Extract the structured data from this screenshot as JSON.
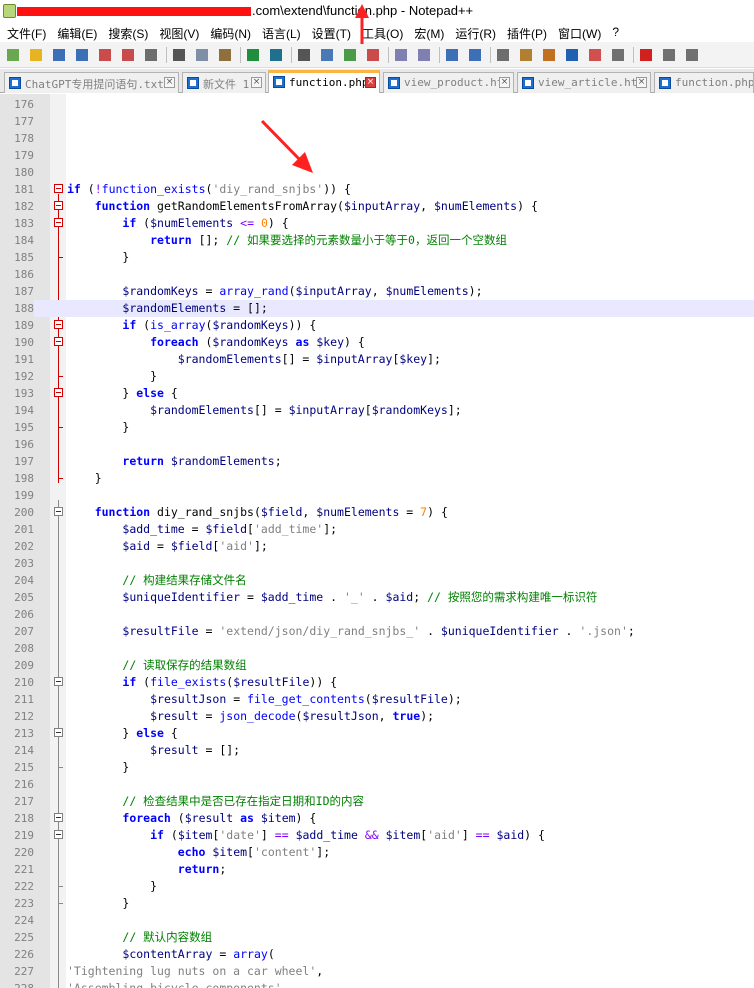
{
  "window": {
    "title": ".com\\extend\\function.php - Notepad++"
  },
  "menu": [
    "文件(F)",
    "编辑(E)",
    "搜索(S)",
    "视图(V)",
    "编码(N)",
    "语言(L)",
    "设置(T)",
    "工具(O)",
    "宏(M)",
    "运行(R)",
    "插件(P)",
    "窗口(W)",
    "?"
  ],
  "toolbar": {
    "buttons": [
      "new-file-icon",
      "open-file-icon",
      "save-icon",
      "save-all-icon",
      "close-icon",
      "close-all-icon",
      "print-icon",
      "cut-icon",
      "copy-icon",
      "paste-icon",
      "undo-icon",
      "redo-icon",
      "find-icon",
      "replace-icon",
      "zoom-in-icon",
      "zoom-out-icon",
      "sync-vertical-icon",
      "sync-horizontal-icon",
      "word-wrap-icon",
      "show-all-chars-icon",
      "indent-guide-icon",
      "doc-map-icon",
      "function-list-icon",
      "folder-workspace-icon",
      "document-list-icon",
      "monitoring-icon",
      "record-macro-icon",
      "stop-record-icon",
      "play-macro-icon"
    ]
  },
  "tabs": [
    {
      "label": "ChatGPT专用提问语句.txt",
      "active": false
    },
    {
      "label": "新文件 1",
      "active": false
    },
    {
      "label": "function.php",
      "active": true
    },
    {
      "label": "view_product.htm",
      "active": false
    },
    {
      "label": "view_article.htm",
      "active": false
    },
    {
      "label": "function.php",
      "active": false
    }
  ],
  "editor": {
    "current_line": 188,
    "lines": [
      {
        "n": "176",
        "t": []
      },
      {
        "n": "177",
        "t": []
      },
      {
        "n": "178",
        "t": []
      },
      {
        "n": "179",
        "t": []
      },
      {
        "n": "180",
        "t": []
      },
      {
        "n": "181",
        "t": [
          [
            "kw",
            "if"
          ],
          [
            "plain",
            " ("
          ],
          [
            "op",
            "!"
          ],
          [
            "fn",
            "function_exists"
          ],
          [
            "plain",
            "("
          ],
          [
            "str",
            "'diy_rand_snjbs'"
          ],
          [
            "plain",
            ")) {"
          ]
        ]
      },
      {
        "n": "182",
        "t": [
          [
            "plain",
            "    "
          ],
          [
            "kw",
            "function"
          ],
          [
            "plain",
            " getRandomElementsFromArray("
          ],
          [
            "var",
            "$inputArray"
          ],
          [
            "plain",
            ", "
          ],
          [
            "var",
            "$numElements"
          ],
          [
            "plain",
            ") {"
          ]
        ]
      },
      {
        "n": "183",
        "t": [
          [
            "plain",
            "        "
          ],
          [
            "kw",
            "if"
          ],
          [
            "plain",
            " ("
          ],
          [
            "var",
            "$numElements"
          ],
          [
            "plain",
            " "
          ],
          [
            "op",
            "<="
          ],
          [
            "plain",
            " "
          ],
          [
            "num",
            "0"
          ],
          [
            "plain",
            ") {"
          ]
        ]
      },
      {
        "n": "184",
        "t": [
          [
            "plain",
            "            "
          ],
          [
            "kw",
            "return"
          ],
          [
            "plain",
            " []; "
          ],
          [
            "cm",
            "// 如果要选择的元素数量小于等于0，返回一个空数组"
          ]
        ]
      },
      {
        "n": "185",
        "t": [
          [
            "plain",
            "        }"
          ]
        ]
      },
      {
        "n": "186",
        "t": []
      },
      {
        "n": "187",
        "t": [
          [
            "plain",
            "        "
          ],
          [
            "var",
            "$randomKeys"
          ],
          [
            "plain",
            " = "
          ],
          [
            "fn",
            "array_rand"
          ],
          [
            "plain",
            "("
          ],
          [
            "var",
            "$inputArray"
          ],
          [
            "plain",
            ", "
          ],
          [
            "var",
            "$numElements"
          ],
          [
            "plain",
            ");"
          ]
        ]
      },
      {
        "n": "188",
        "t": [
          [
            "plain",
            "        "
          ],
          [
            "var",
            "$randomElements"
          ],
          [
            "plain",
            " = [];"
          ]
        ]
      },
      {
        "n": "189",
        "t": [
          [
            "plain",
            "        "
          ],
          [
            "kw",
            "if"
          ],
          [
            "plain",
            " ("
          ],
          [
            "fn",
            "is_array"
          ],
          [
            "plain",
            "("
          ],
          [
            "var",
            "$randomKeys"
          ],
          [
            "plain",
            ")) {"
          ]
        ]
      },
      {
        "n": "190",
        "t": [
          [
            "plain",
            "            "
          ],
          [
            "kw",
            "foreach"
          ],
          [
            "plain",
            " ("
          ],
          [
            "var",
            "$randomKeys"
          ],
          [
            "plain",
            " "
          ],
          [
            "kw",
            "as"
          ],
          [
            "plain",
            " "
          ],
          [
            "var",
            "$key"
          ],
          [
            "plain",
            ") {"
          ]
        ]
      },
      {
        "n": "191",
        "t": [
          [
            "plain",
            "                "
          ],
          [
            "var",
            "$randomElements"
          ],
          [
            "plain",
            "[] = "
          ],
          [
            "var",
            "$inputArray"
          ],
          [
            "plain",
            "["
          ],
          [
            "var",
            "$key"
          ],
          [
            "plain",
            "];"
          ]
        ]
      },
      {
        "n": "192",
        "t": [
          [
            "plain",
            "            }"
          ]
        ]
      },
      {
        "n": "193",
        "t": [
          [
            "plain",
            "        } "
          ],
          [
            "kw",
            "else"
          ],
          [
            "plain",
            " {"
          ]
        ]
      },
      {
        "n": "194",
        "t": [
          [
            "plain",
            "            "
          ],
          [
            "var",
            "$randomElements"
          ],
          [
            "plain",
            "[] = "
          ],
          [
            "var",
            "$inputArray"
          ],
          [
            "plain",
            "["
          ],
          [
            "var",
            "$randomKeys"
          ],
          [
            "plain",
            "];"
          ]
        ]
      },
      {
        "n": "195",
        "t": [
          [
            "plain",
            "        }"
          ]
        ]
      },
      {
        "n": "196",
        "t": []
      },
      {
        "n": "197",
        "t": [
          [
            "plain",
            "        "
          ],
          [
            "kw",
            "return"
          ],
          [
            "plain",
            " "
          ],
          [
            "var",
            "$randomElements"
          ],
          [
            "plain",
            ";"
          ]
        ]
      },
      {
        "n": "198",
        "t": [
          [
            "plain",
            "    }"
          ]
        ]
      },
      {
        "n": "199",
        "t": []
      },
      {
        "n": "200",
        "t": [
          [
            "plain",
            "    "
          ],
          [
            "kw",
            "function"
          ],
          [
            "plain",
            " diy_rand_snjbs("
          ],
          [
            "var",
            "$field"
          ],
          [
            "plain",
            ", "
          ],
          [
            "var",
            "$numElements"
          ],
          [
            "plain",
            " = "
          ],
          [
            "num",
            "7"
          ],
          [
            "plain",
            ") {"
          ]
        ]
      },
      {
        "n": "201",
        "t": [
          [
            "plain",
            "        "
          ],
          [
            "var",
            "$add_time"
          ],
          [
            "plain",
            " = "
          ],
          [
            "var",
            "$field"
          ],
          [
            "plain",
            "["
          ],
          [
            "str",
            "'add_time'"
          ],
          [
            "plain",
            "];"
          ]
        ]
      },
      {
        "n": "202",
        "t": [
          [
            "plain",
            "        "
          ],
          [
            "var",
            "$aid"
          ],
          [
            "plain",
            " = "
          ],
          [
            "var",
            "$field"
          ],
          [
            "plain",
            "["
          ],
          [
            "str",
            "'aid'"
          ],
          [
            "plain",
            "];"
          ]
        ]
      },
      {
        "n": "203",
        "t": []
      },
      {
        "n": "204",
        "t": [
          [
            "plain",
            "        "
          ],
          [
            "cm",
            "// 构建结果存储文件名"
          ]
        ]
      },
      {
        "n": "205",
        "t": [
          [
            "plain",
            "        "
          ],
          [
            "var",
            "$uniqueIdentifier"
          ],
          [
            "plain",
            " = "
          ],
          [
            "var",
            "$add_time"
          ],
          [
            "plain",
            " . "
          ],
          [
            "str",
            "'_'"
          ],
          [
            "plain",
            " . "
          ],
          [
            "var",
            "$aid"
          ],
          [
            "plain",
            "; "
          ],
          [
            "cm",
            "// 按照您的需求构建唯一标识符"
          ]
        ]
      },
      {
        "n": "206",
        "t": []
      },
      {
        "n": "207",
        "t": [
          [
            "plain",
            "        "
          ],
          [
            "var",
            "$resultFile"
          ],
          [
            "plain",
            " = "
          ],
          [
            "str",
            "'extend/json/diy_rand_snjbs_'"
          ],
          [
            "plain",
            " . "
          ],
          [
            "var",
            "$uniqueIdentifier"
          ],
          [
            "plain",
            " . "
          ],
          [
            "str",
            "'.json'"
          ],
          [
            "plain",
            ";"
          ]
        ]
      },
      {
        "n": "208",
        "t": []
      },
      {
        "n": "209",
        "t": [
          [
            "plain",
            "        "
          ],
          [
            "cm",
            "// 读取保存的结果数组"
          ]
        ]
      },
      {
        "n": "210",
        "t": [
          [
            "plain",
            "        "
          ],
          [
            "kw",
            "if"
          ],
          [
            "plain",
            " ("
          ],
          [
            "fn",
            "file_exists"
          ],
          [
            "plain",
            "("
          ],
          [
            "var",
            "$resultFile"
          ],
          [
            "plain",
            ")) {"
          ]
        ]
      },
      {
        "n": "211",
        "t": [
          [
            "plain",
            "            "
          ],
          [
            "var",
            "$resultJson"
          ],
          [
            "plain",
            " = "
          ],
          [
            "fn",
            "file_get_contents"
          ],
          [
            "plain",
            "("
          ],
          [
            "var",
            "$resultFile"
          ],
          [
            "plain",
            ");"
          ]
        ]
      },
      {
        "n": "212",
        "t": [
          [
            "plain",
            "            "
          ],
          [
            "var",
            "$result"
          ],
          [
            "plain",
            " = "
          ],
          [
            "fn",
            "json_decode"
          ],
          [
            "plain",
            "("
          ],
          [
            "var",
            "$resultJson"
          ],
          [
            "plain",
            ", "
          ],
          [
            "kw",
            "true"
          ],
          [
            "plain",
            ");"
          ]
        ]
      },
      {
        "n": "213",
        "t": [
          [
            "plain",
            "        } "
          ],
          [
            "kw",
            "else"
          ],
          [
            "plain",
            " {"
          ]
        ]
      },
      {
        "n": "214",
        "t": [
          [
            "plain",
            "            "
          ],
          [
            "var",
            "$result"
          ],
          [
            "plain",
            " = [];"
          ]
        ]
      },
      {
        "n": "215",
        "t": [
          [
            "plain",
            "        }"
          ]
        ]
      },
      {
        "n": "216",
        "t": []
      },
      {
        "n": "217",
        "t": [
          [
            "plain",
            "        "
          ],
          [
            "cm",
            "// 检查结果中是否已存在指定日期和ID的内容"
          ]
        ]
      },
      {
        "n": "218",
        "t": [
          [
            "plain",
            "        "
          ],
          [
            "kw",
            "foreach"
          ],
          [
            "plain",
            " ("
          ],
          [
            "var",
            "$result"
          ],
          [
            "plain",
            " "
          ],
          [
            "kw",
            "as"
          ],
          [
            "plain",
            " "
          ],
          [
            "var",
            "$item"
          ],
          [
            "plain",
            ") {"
          ]
        ]
      },
      {
        "n": "219",
        "t": [
          [
            "plain",
            "            "
          ],
          [
            "kw",
            "if"
          ],
          [
            "plain",
            " ("
          ],
          [
            "var",
            "$item"
          ],
          [
            "plain",
            "["
          ],
          [
            "str",
            "'date'"
          ],
          [
            "plain",
            "] "
          ],
          [
            "op",
            "=="
          ],
          [
            "plain",
            " "
          ],
          [
            "var",
            "$add_time"
          ],
          [
            "plain",
            " "
          ],
          [
            "op",
            "&&"
          ],
          [
            "plain",
            " "
          ],
          [
            "var",
            "$item"
          ],
          [
            "plain",
            "["
          ],
          [
            "str",
            "'aid'"
          ],
          [
            "plain",
            "] "
          ],
          [
            "op",
            "=="
          ],
          [
            "plain",
            " "
          ],
          [
            "var",
            "$aid"
          ],
          [
            "plain",
            ") {"
          ]
        ]
      },
      {
        "n": "220",
        "t": [
          [
            "plain",
            "                "
          ],
          [
            "kw",
            "echo"
          ],
          [
            "plain",
            " "
          ],
          [
            "var",
            "$item"
          ],
          [
            "plain",
            "["
          ],
          [
            "str",
            "'content'"
          ],
          [
            "plain",
            "];"
          ]
        ]
      },
      {
        "n": "221",
        "t": [
          [
            "plain",
            "                "
          ],
          [
            "kw",
            "return"
          ],
          [
            "plain",
            ";"
          ]
        ]
      },
      {
        "n": "222",
        "t": [
          [
            "plain",
            "            }"
          ]
        ]
      },
      {
        "n": "223",
        "t": [
          [
            "plain",
            "        }"
          ]
        ]
      },
      {
        "n": "224",
        "t": []
      },
      {
        "n": "225",
        "t": [
          [
            "plain",
            "        "
          ],
          [
            "cm",
            "// 默认内容数组"
          ]
        ]
      },
      {
        "n": "226",
        "t": [
          [
            "plain",
            "        "
          ],
          [
            "var",
            "$contentArray"
          ],
          [
            "plain",
            " = "
          ],
          [
            "fn",
            "array"
          ],
          [
            "plain",
            "("
          ]
        ]
      },
      {
        "n": "227",
        "t": [
          [
            "str",
            "'Tightening lug nuts on a car wheel'"
          ],
          [
            "plain",
            ","
          ]
        ]
      },
      {
        "n": "228",
        "t": [
          [
            "str",
            "'Assembling bicycle components'"
          ]
        ]
      }
    ]
  },
  "colors": {
    "keyword": "#0000ff",
    "variable": "#000080",
    "string": "#808080",
    "number": "#ff8000",
    "operator": "#8000ff",
    "comment": "#008000",
    "current_line": "#e8e8ff",
    "fold_marker_changed": "#d00000",
    "annotation_arrow": "#ff1111"
  }
}
